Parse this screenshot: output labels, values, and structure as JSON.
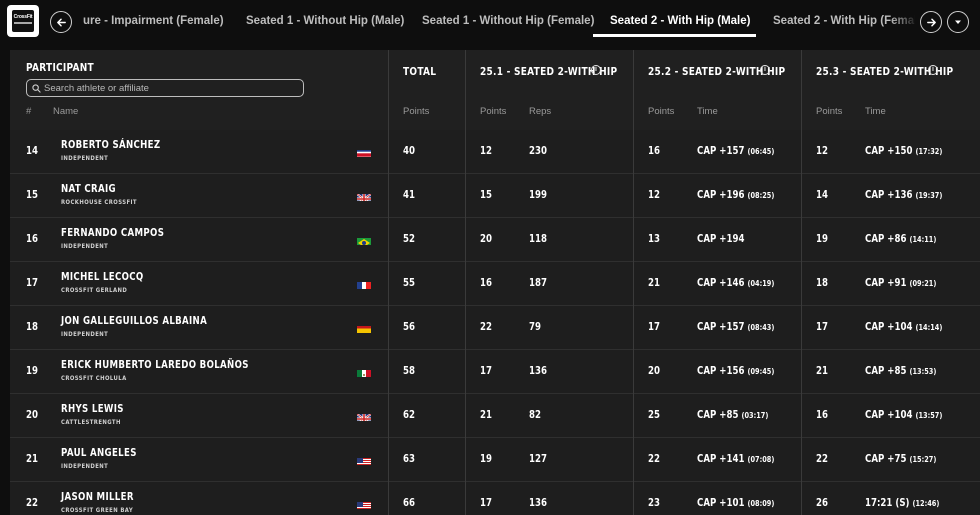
{
  "logo": {
    "brand_text": "CrossFit"
  },
  "tabs": [
    {
      "label": "ure - Impairment (Female)",
      "active": false
    },
    {
      "label": "Seated 1 - Without Hip (Male)",
      "active": false
    },
    {
      "label": "Seated 1 - Without Hip (Female)",
      "active": false
    },
    {
      "label": "Seated 2 - With Hip (Male)",
      "active": true
    },
    {
      "label": "Seated 2 - With Hip (Female",
      "active": false
    }
  ],
  "nav": {
    "prev_icon": "arrow-left-icon",
    "next_icon": "arrow-right-icon",
    "menu_icon": "caret-down-icon"
  },
  "table": {
    "participant_header": "PARTICIPANT",
    "search_placeholder": "Search athlete or affiliate",
    "col_rank": "#",
    "col_name": "Name",
    "total_header": "TOTAL",
    "total_sub": "Points",
    "workouts": [
      {
        "title": "25.1 - SEATED 2-WITH HIP",
        "sub1": "Points",
        "sub2": "Reps"
      },
      {
        "title": "25.2 - SEATED 2-WITH HIP",
        "sub1": "Points",
        "sub2": "Time"
      },
      {
        "title": "25.3 - SEATED 2-WITH HIP",
        "sub1": "Points",
        "sub2": "Time"
      }
    ],
    "rows": [
      {
        "rank": "14",
        "name": "ROBERTO SÁNCHEZ",
        "affiliate": "INDEPENDENT",
        "flag": "cr",
        "total": "40",
        "w1_pts": "12",
        "w1_res": "230",
        "w2_pts": "16",
        "w2_res": "CAP +157",
        "w2_time": "(06:45)",
        "w3_pts": "12",
        "w3_res": "CAP +150",
        "w3_time": "(17:32)"
      },
      {
        "rank": "15",
        "name": "NAT CRAIG",
        "affiliate": "ROCKHOUSE CROSSFIT",
        "flag": "gb",
        "total": "41",
        "w1_pts": "15",
        "w1_res": "199",
        "w2_pts": "12",
        "w2_res": "CAP +196",
        "w2_time": "(08:25)",
        "w3_pts": "14",
        "w3_res": "CAP +136",
        "w3_time": "(19:37)"
      },
      {
        "rank": "16",
        "name": "FERNANDO CAMPOS",
        "affiliate": "INDEPENDENT",
        "flag": "br",
        "total": "52",
        "w1_pts": "20",
        "w1_res": "118",
        "w2_pts": "13",
        "w2_res": "CAP +194",
        "w2_time": "",
        "w3_pts": "19",
        "w3_res": "CAP +86",
        "w3_time": "(14:11)"
      },
      {
        "rank": "17",
        "name": "MICHEL LECOCQ",
        "affiliate": "CROSSFIT GERLAND",
        "flag": "fr",
        "total": "55",
        "w1_pts": "16",
        "w1_res": "187",
        "w2_pts": "21",
        "w2_res": "CAP +146",
        "w2_time": "(04:19)",
        "w3_pts": "18",
        "w3_res": "CAP +91",
        "w3_time": "(09:21)"
      },
      {
        "rank": "18",
        "name": "JON GALLEGUILLOS ALBAINA",
        "affiliate": "INDEPENDENT",
        "flag": "es",
        "total": "56",
        "w1_pts": "22",
        "w1_res": "79",
        "w2_pts": "17",
        "w2_res": "CAP +157",
        "w2_time": "(08:43)",
        "w3_pts": "17",
        "w3_res": "CAP +104",
        "w3_time": "(14:14)"
      },
      {
        "rank": "19",
        "name": "ERICK HUMBERTO LAREDO BOLAÑOS",
        "affiliate": "CROSSFIT CHOLULA",
        "flag": "mx",
        "total": "58",
        "w1_pts": "17",
        "w1_res": "136",
        "w2_pts": "20",
        "w2_res": "CAP +156",
        "w2_time": "(09:45)",
        "w3_pts": "21",
        "w3_res": "CAP +85",
        "w3_time": "(13:53)"
      },
      {
        "rank": "20",
        "name": "RHYS LEWIS",
        "affiliate": "CATTLESTRENGTH",
        "flag": "gb",
        "total": "62",
        "w1_pts": "21",
        "w1_res": "82",
        "w2_pts": "25",
        "w2_res": "CAP +85",
        "w2_time": "(03:17)",
        "w3_pts": "16",
        "w3_res": "CAP +104",
        "w3_time": "(13:57)"
      },
      {
        "rank": "21",
        "name": "PAUL ANGELES",
        "affiliate": "INDEPENDENT",
        "flag": "us",
        "total": "63",
        "w1_pts": "19",
        "w1_res": "127",
        "w2_pts": "22",
        "w2_res": "CAP +141",
        "w2_time": "(07:08)",
        "w3_pts": "22",
        "w3_res": "CAP +75",
        "w3_time": "(15:27)"
      },
      {
        "rank": "22",
        "name": "JASON MILLER",
        "affiliate": "CROSSFIT GREEN BAY",
        "flag": "us",
        "total": "66",
        "w1_pts": "17",
        "w1_res": "136",
        "w2_pts": "23",
        "w2_res": "CAP +101",
        "w2_time": "(08:09)",
        "w3_pts": "26",
        "w3_res": "17:21 (S)",
        "w3_time": "(12:46)"
      }
    ]
  }
}
